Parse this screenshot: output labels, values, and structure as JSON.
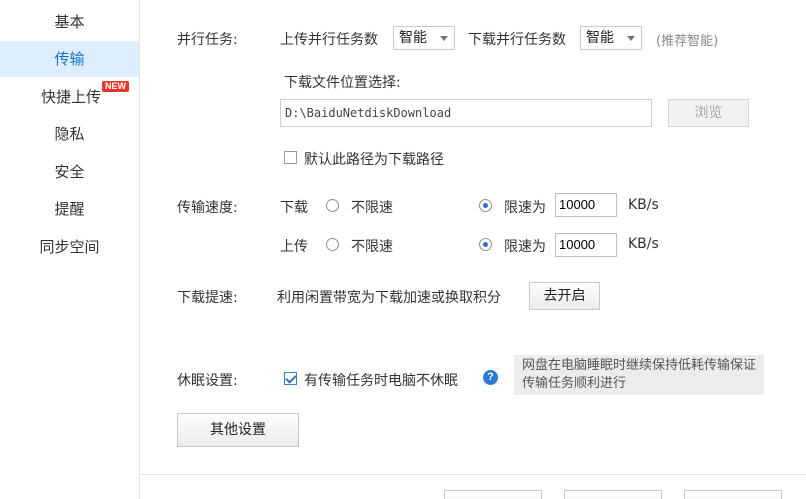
{
  "sidebar": {
    "items": [
      {
        "label": "基本",
        "active": false
      },
      {
        "label": "传输",
        "active": true
      },
      {
        "label": "快捷上传",
        "active": false,
        "badge": "NEW"
      },
      {
        "label": "隐私",
        "active": false
      },
      {
        "label": "安全",
        "active": false
      },
      {
        "label": "提醒",
        "active": false
      },
      {
        "label": "同步空间",
        "active": false
      }
    ]
  },
  "parallel": {
    "label": "并行任务:",
    "upload_label": "上传并行任务数",
    "upload_value": "智能",
    "download_label": "下载并行任务数",
    "download_value": "智能",
    "hint": "(推荐智能)"
  },
  "download_location": {
    "label": "下载文件位置选择:",
    "path": "D:\\BaiduNetdiskDownload",
    "browse_label": "浏览",
    "default_checkbox_label": "默认此路径为下载路径",
    "default_checked": false
  },
  "speed": {
    "label": "传输速度:",
    "download": {
      "label": "下载",
      "unlimited_label": "不限速",
      "limit_label": "限速为",
      "value": "10000",
      "unit": "KB/s",
      "mode": "limit"
    },
    "upload": {
      "label": "上传",
      "unlimited_label": "不限速",
      "limit_label": "限速为",
      "value": "10000",
      "unit": "KB/s",
      "mode": "limit"
    }
  },
  "boost": {
    "label": "下载提速:",
    "description": "利用闲置带宽为下载加速或换取积分",
    "button_label": "去开启"
  },
  "sleep": {
    "label": "休眠设置:",
    "checkbox_label": "有传输任务时电脑不休眠",
    "checked": true,
    "help_icon": "question-icon",
    "tip": "网盘在电脑睡眠时继续保持低耗传输保证传输任务顺利进行"
  },
  "other_settings_label": "其他设置",
  "colors": {
    "accent": "#2f73c0",
    "active_bg": "#ddeeff",
    "badge": "#e6362c"
  }
}
